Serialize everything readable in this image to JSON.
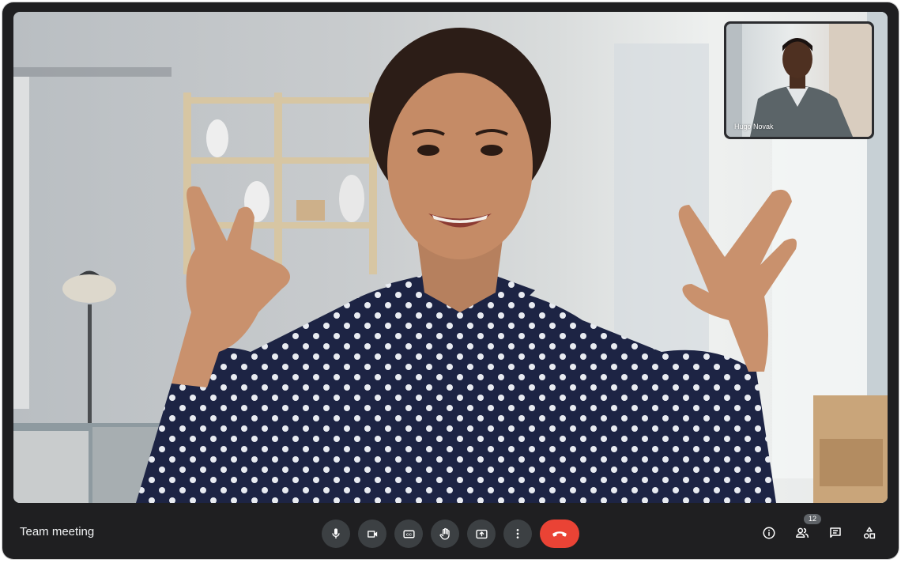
{
  "meeting": {
    "title": "Team meeting"
  },
  "pip": {
    "participant_name": "Hugo Novak"
  },
  "controls": [
    {
      "name": "microphone",
      "icon": "mic-icon"
    },
    {
      "name": "camera",
      "icon": "videocam-icon"
    },
    {
      "name": "captions",
      "icon": "closed-caption-icon"
    },
    {
      "name": "raise-hand",
      "icon": "hand-icon"
    },
    {
      "name": "present",
      "icon": "present-screen-icon"
    },
    {
      "name": "more-options",
      "icon": "more-vert-icon"
    },
    {
      "name": "leave-call",
      "icon": "call-end-icon"
    }
  ],
  "side_controls": {
    "participant_count": "12",
    "icons": [
      "info-icon",
      "people-icon",
      "chat-icon",
      "activities-icon"
    ]
  },
  "colors": {
    "end_call": "#ea4335",
    "button_bg": "#3c4043",
    "frame": "#1f1f21"
  }
}
